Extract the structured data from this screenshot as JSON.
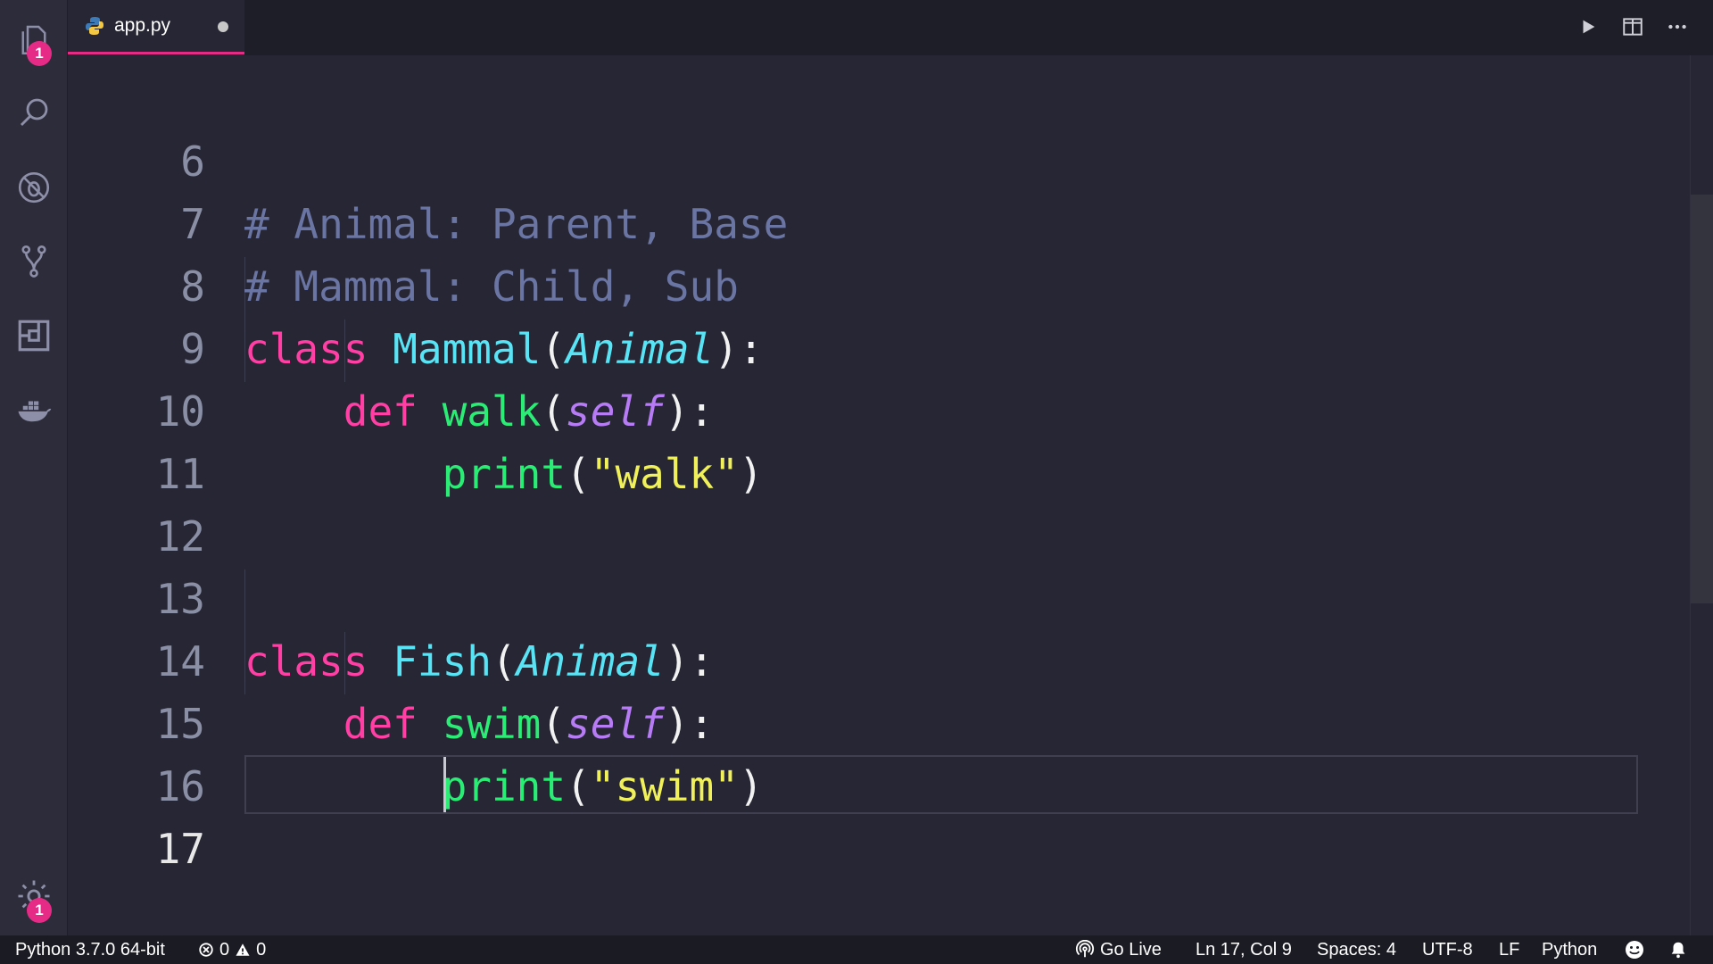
{
  "tab": {
    "filename": "app.py"
  },
  "activity": {
    "explorer_badge": "1",
    "settings_badge": "1"
  },
  "editor": {
    "lines": [
      {
        "number": "6",
        "active": false
      },
      {
        "number": "7",
        "active": false
      },
      {
        "number": "8",
        "active": false
      },
      {
        "number": "9",
        "active": false
      },
      {
        "number": "10",
        "active": false
      },
      {
        "number": "11",
        "active": false
      },
      {
        "number": "12",
        "active": false
      },
      {
        "number": "13",
        "active": false
      },
      {
        "number": "14",
        "active": false
      },
      {
        "number": "15",
        "active": false
      },
      {
        "number": "16",
        "active": false
      },
      {
        "number": "17",
        "active": true
      }
    ],
    "code": {
      "l6": "# Animal: Parent, Base",
      "l7": "# Mammal: Child, Sub",
      "class_kw": "class",
      "def_kw": "def",
      "mammal": "Mammal",
      "fish": "Fish",
      "base": "Animal",
      "walk": "walk",
      "swim": "swim",
      "self": "self",
      "print": "print",
      "str_walk": "\"walk\"",
      "str_swim": "\"swim\""
    }
  },
  "status": {
    "interpreter": "Python 3.7.0 64-bit",
    "errors": "0",
    "warnings": "0",
    "go_live": "Go Live",
    "cursor_pos": "Ln 17, Col 9",
    "spaces": "Spaces: 4",
    "encoding": "UTF-8",
    "eol": "LF",
    "language": "Python"
  },
  "colors": {
    "accent": "#e62b86",
    "keyword": "#ff3fa4",
    "class": "#59e4f5",
    "function": "#2bed76",
    "self": "#b77cf5",
    "string": "#f0f05a",
    "comment": "#6b75a3"
  }
}
